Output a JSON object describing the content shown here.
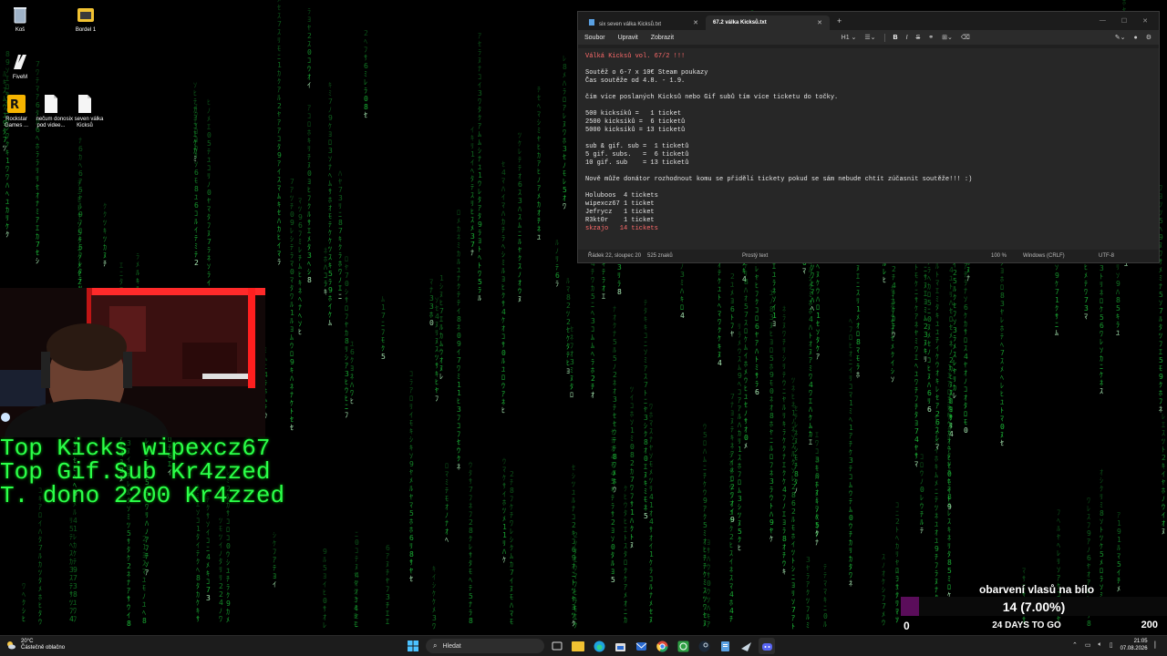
{
  "desktop": {
    "icons": [
      {
        "label": "Koš",
        "icon": "recycle-bin-icon"
      },
      {
        "label": "Bordel 1",
        "icon": "folder-icon"
      },
      {
        "label": "FiveM",
        "icon": "fivem-icon"
      },
      {
        "label": "Rockstar Games ...",
        "icon": "rockstar-icon"
      },
      {
        "label": "nečum dono pod videe...",
        "icon": "text-file-icon"
      },
      {
        "label": "six seven válka Kicksů",
        "icon": "text-file-icon"
      }
    ]
  },
  "notepad": {
    "tabs": [
      {
        "label": "six seven válka Kicksů.txt",
        "active": false
      },
      {
        "label": "67.2 válka Kicksů.txt",
        "active": true
      }
    ],
    "menu": [
      "Soubor",
      "Upravit",
      "Zobrazit"
    ],
    "toolbar": {
      "heading": "H1",
      "bold": "B",
      "italic": "I"
    },
    "lines": [
      "Válká Kicksů vol. 67/2 !!!",
      "",
      "Soutěž o 6-7 x 10€ Steam poukazy",
      "Čas soutěže od 4.8. - 1.9.",
      "",
      "čím více poslaných Kicksů nebo Gif subů tím více ticketu do točky.",
      "",
      "500 kicksíků =   1 ticket",
      "2500 kicksíků =  6 ticketů",
      "5000 kicksíků = 13 ticketů",
      "",
      "sub & gif. sub =  1 ticketů",
      "5 gif. subs.   =  6 ticketů",
      "10 gif. sub    = 13 ticketů",
      "",
      "Nově může donátor rozhodnout komu se přidělí tickety pokud se sám nebude chtít zúčasnit soutěže!!! :)",
      "",
      "Holuboos  4 tickets",
      "wipexcz67 1 ticket",
      "Jefrycz   1 ticket",
      "R3kt0r    1 ticket",
      "skzajo   14 tickets"
    ],
    "status": {
      "position": "Řádek 22, sloupec 20",
      "chars": "525 znaků",
      "format": "Prostý text",
      "zoom": "100 %",
      "line_ending": "Windows (CRLF)",
      "encoding": "UTF-8"
    }
  },
  "overlay": {
    "lines": [
      "Top Kicks wipexcz67",
      "Top Gif.Sub Kr4zzed",
      "T. dono 2200 Kr4zzed"
    ],
    "color": "#2bff4a"
  },
  "goal": {
    "title": "obarvení vlasů na bílo",
    "current": 14,
    "target": 200,
    "display": "14 (7.00%)",
    "progress_fraction": 0.07,
    "min_label": "0",
    "max_label": "200",
    "days_label": "24 DAYS TO GO",
    "fill_color": "#5a0d5a"
  },
  "taskbar": {
    "weather_temp": "20°C",
    "weather_desc": "Částečně oblačno",
    "search_placeholder": "Hledat",
    "time": "21:05",
    "date": "07.08.2026",
    "apps": [
      "windows-start-icon",
      "search-icon",
      "task-view-icon",
      "folder-icon",
      "edge-icon",
      "store-icon",
      "mail-icon",
      "chrome-icon",
      "xbox-icon",
      "steam-icon",
      "notepad-icon",
      "steam-icon-2",
      "discord-icon"
    ]
  }
}
